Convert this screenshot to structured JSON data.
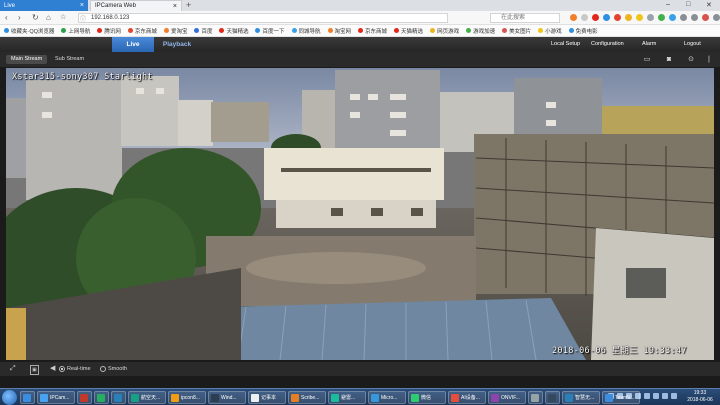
{
  "browser": {
    "tabs": [
      {
        "label": "Live",
        "active": true
      },
      {
        "label": "IPCamera Web",
        "active": false
      }
    ],
    "new_tab": "+",
    "window_controls": {
      "min": "–",
      "max": "□",
      "close": "✕"
    },
    "address": "192.168.0.123",
    "search_placeholder": "在此搜索",
    "bookmarks": [
      "收藏夹·QQ浏览器",
      "上网导航",
      "腾讯网",
      "京东商城",
      "爱淘宝",
      "百度",
      "天猫精选",
      "百度一下",
      "同城导航",
      "淘宝网",
      "京东商城",
      "天猫精选",
      "网页游戏",
      "游戏加速",
      "美女图片",
      "小游戏",
      "免费电影"
    ]
  },
  "app": {
    "tabs": {
      "live": "Live",
      "playback": "Playback"
    },
    "menu": {
      "local_setup": "Local Setup",
      "configuration": "Configuration",
      "alarm": "Alarm",
      "logout": "Logout"
    },
    "streams": {
      "main": "Main Stream",
      "sub": "Sub Stream"
    },
    "osd_title": "Xstar315-sony307  Starlight",
    "osd_timestamp": "2018-06-06 星期三  19:33:47",
    "controls": {
      "realtime": "Real-time",
      "smooth": "Smooth"
    }
  },
  "taskbar": {
    "items": [
      "",
      "IPCam...",
      "",
      "",
      "",
      "航空天...",
      "ipcon8...",
      "Wind...",
      "记事本",
      "Scribe...",
      "避雷...",
      "Micro...",
      "微信",
      "AI设备...",
      "ONVIF...",
      "",
      "",
      "智慧无...",
      "TeamV..."
    ],
    "clock_time": "19:33",
    "clock_date": "2018-06-06"
  },
  "colors": {
    "accent": "#2a66b4",
    "browser_tab": "#2f7fd3",
    "header": "#262626"
  }
}
